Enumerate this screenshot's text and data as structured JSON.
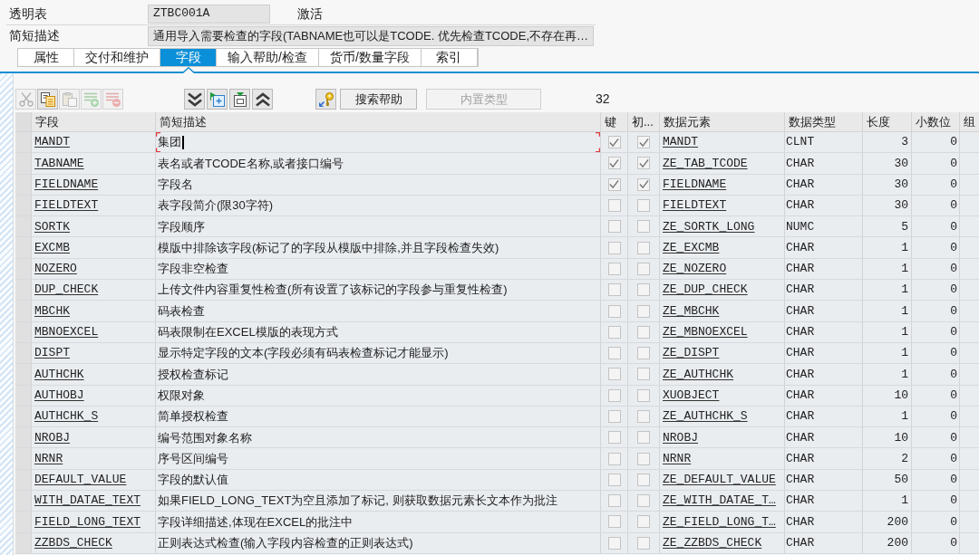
{
  "header": {
    "table_type_label": "透明表",
    "table_name": "ZTBC001A",
    "status": "激活",
    "description_label": "简短描述",
    "description": "通用导入需要检查的字段(TABNAME也可以是TCODE. 优先检查TCODE,不存在再…"
  },
  "tabs": [
    {
      "label": "属性",
      "selected": false
    },
    {
      "label": "交付和维护",
      "selected": false
    },
    {
      "label": "字段",
      "selected": true
    },
    {
      "label": "输入帮助/检查",
      "selected": false
    },
    {
      "label": "货币/数量字段",
      "selected": false
    },
    {
      "label": "索引",
      "selected": false
    }
  ],
  "toolbar": {
    "edit_buttons": [
      {
        "kind": "cut",
        "disabled": true
      },
      {
        "kind": "copy",
        "disabled": false
      },
      {
        "kind": "paste",
        "disabled": true
      },
      {
        "kind": "add",
        "disabled": true
      },
      {
        "kind": "remove",
        "disabled": true
      }
    ],
    "move_buttons": [
      {
        "kind": "down",
        "disabled": false
      },
      {
        "kind": "insert",
        "disabled": false
      },
      {
        "kind": "append",
        "disabled": false
      },
      {
        "kind": "up",
        "disabled": false
      }
    ],
    "key_button": {
      "disabled": false
    },
    "search_help": {
      "label": "搜索帮助",
      "disabled": false
    },
    "builtin_type": {
      "label": "内置类型",
      "disabled": true
    },
    "count": "32"
  },
  "table": {
    "columns": [
      "字段",
      "简短描述",
      "键",
      "初...",
      "数据元素",
      "数据类型",
      "长度",
      "小数位",
      "组"
    ],
    "rows": [
      {
        "field": "MANDT",
        "description": "集团",
        "key": true,
        "initial": true,
        "data_element": "MANDT",
        "data_type": "CLNT",
        "length": "3",
        "decimals": "0",
        "focused": true
      },
      {
        "field": "TABNAME",
        "description": "表名或者TCODE名称,或者接口编号",
        "key": true,
        "initial": true,
        "data_element": "ZE_TAB_TCODE",
        "data_type": "CHAR",
        "length": "30",
        "decimals": "0",
        "focused": false
      },
      {
        "field": "FIELDNAME",
        "description": "字段名",
        "key": true,
        "initial": true,
        "data_element": "FIELDNAME",
        "data_type": "CHAR",
        "length": "30",
        "decimals": "0",
        "focused": false
      },
      {
        "field": "FIELDTEXT",
        "description": "表字段简介(限30字符)",
        "key": false,
        "initial": false,
        "data_element": "FIELDTEXT",
        "data_type": "CHAR",
        "length": "30",
        "decimals": "0",
        "focused": false
      },
      {
        "field": "SORTK",
        "description": "字段顺序",
        "key": false,
        "initial": false,
        "data_element": "ZE_SORTK_LONG",
        "data_type": "NUMC",
        "length": "5",
        "decimals": "0",
        "focused": false
      },
      {
        "field": "EXCMB",
        "description": "模版中排除该字段(标记了的字段从模版中排除,并且字段检查失效)",
        "key": false,
        "initial": false,
        "data_element": "ZE_EXCMB",
        "data_type": "CHAR",
        "length": "1",
        "decimals": "0",
        "focused": false
      },
      {
        "field": "NOZERO",
        "description": "字段非空检查",
        "key": false,
        "initial": false,
        "data_element": "ZE_NOZERO",
        "data_type": "CHAR",
        "length": "1",
        "decimals": "0",
        "focused": false
      },
      {
        "field": "DUP_CHECK",
        "description": "上传文件内容重复性检查(所有设置了该标记的字段参与重复性检查)",
        "key": false,
        "initial": false,
        "data_element": "ZE_DUP_CHECK",
        "data_type": "CHAR",
        "length": "1",
        "decimals": "0",
        "focused": false
      },
      {
        "field": "MBCHK",
        "description": "码表检查",
        "key": false,
        "initial": false,
        "data_element": "ZE_MBCHK",
        "data_type": "CHAR",
        "length": "1",
        "decimals": "0",
        "focused": false
      },
      {
        "field": "MBNOEXCEL",
        "description": "码表限制在EXCEL模版的表现方式",
        "key": false,
        "initial": false,
        "data_element": "ZE_MBNOEXCEL",
        "data_type": "CHAR",
        "length": "1",
        "decimals": "0",
        "focused": false
      },
      {
        "field": "DISPT",
        "description": "显示特定字段的文本(字段必须有码表检查标记才能显示)",
        "key": false,
        "initial": false,
        "data_element": "ZE_DISPT",
        "data_type": "CHAR",
        "length": "1",
        "decimals": "0",
        "focused": false
      },
      {
        "field": "AUTHCHK",
        "description": "授权检查标记",
        "key": false,
        "initial": false,
        "data_element": "ZE_AUTHCHK",
        "data_type": "CHAR",
        "length": "1",
        "decimals": "0",
        "focused": false
      },
      {
        "field": "AUTHOBJ",
        "description": "权限对象",
        "key": false,
        "initial": false,
        "data_element": "XUOBJECT",
        "data_type": "CHAR",
        "length": "10",
        "decimals": "0",
        "focused": false
      },
      {
        "field": "AUTHCHK_S",
        "description": "简单授权检查",
        "key": false,
        "initial": false,
        "data_element": "ZE_AUTHCHK_S",
        "data_type": "CHAR",
        "length": "1",
        "decimals": "0",
        "focused": false
      },
      {
        "field": "NROBJ",
        "description": "编号范围对象名称",
        "key": false,
        "initial": false,
        "data_element": "NROBJ",
        "data_type": "CHAR",
        "length": "10",
        "decimals": "0",
        "focused": false
      },
      {
        "field": "NRNR",
        "description": "序号区间编号",
        "key": false,
        "initial": false,
        "data_element": "NRNR",
        "data_type": "CHAR",
        "length": "2",
        "decimals": "0",
        "focused": false
      },
      {
        "field": "DEFAULT_VALUE",
        "description": "字段的默认值",
        "key": false,
        "initial": false,
        "data_element": "ZE_DEFAULT_VALUE",
        "data_type": "CHAR",
        "length": "50",
        "decimals": "0",
        "focused": false
      },
      {
        "field": "WITH_DATAE_TEXT",
        "description": "如果FIELD_LONG_TEXT为空且添加了标记, 则获取数据元素长文本作为批注",
        "key": false,
        "initial": false,
        "data_element": "ZE_WITH_DATAE_T…",
        "data_type": "CHAR",
        "length": "1",
        "decimals": "0",
        "focused": false
      },
      {
        "field": "FIELD_LONG_TEXT",
        "description": "字段详细描述,体现在EXCEL的批注中",
        "key": false,
        "initial": false,
        "data_element": "ZE_FIELD_LONG_T…",
        "data_type": "CHAR",
        "length": "200",
        "decimals": "0",
        "focused": false
      },
      {
        "field": "ZZBDS_CHECK",
        "description": "正则表达式检查(输入字段内容检查的正则表达式)",
        "key": false,
        "initial": false,
        "data_element": "ZE_ZZBDS_CHECK",
        "data_type": "CHAR",
        "length": "200",
        "decimals": "0",
        "focused": false
      }
    ]
  }
}
